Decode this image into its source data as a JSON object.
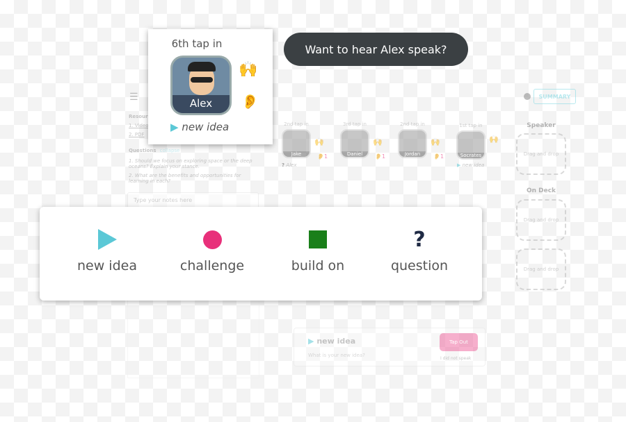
{
  "popup": {
    "tap_label": "6th tap in",
    "name": "Alex",
    "contribution": "new idea"
  },
  "bubble": {
    "text": "Want to hear Alex speak?"
  },
  "sidebar": {
    "resources_label": "Resources",
    "links": [
      "1. Video",
      "2. PDF"
    ],
    "questions_label": "Questions",
    "collapse": "collapse",
    "questions": [
      "1. Should we focus on exploring space or the deep oceans? Explain your stance.",
      "2. What are the benefits and opportunities for learning in each?"
    ],
    "notes_placeholder": "Type your notes here"
  },
  "header": {
    "summary_label": "SUMMARY"
  },
  "participants": [
    {
      "tap": "2nd tap in",
      "name": "Jake",
      "ear_count": "1",
      "note": "Alex"
    },
    {
      "tap": "3rd tap in",
      "name": "Daniel",
      "ear_count": "1"
    },
    {
      "tap": "2nd tap in",
      "name": "Jordan",
      "ear_count": "1"
    },
    {
      "tap": "1st tap in",
      "name": "Socrates",
      "note": "new idea"
    }
  ],
  "speaker": {
    "label": "Speaker",
    "drop": "Drag and drop"
  },
  "on_deck": {
    "label": "On Deck",
    "drops": [
      "Drag and drop",
      "Drag and drop"
    ]
  },
  "legend": {
    "items": [
      {
        "icon": "play-triangle-icon",
        "label": "new idea",
        "color": "#5bc8d6"
      },
      {
        "icon": "circle-icon",
        "label": "challenge",
        "color": "#e8307a"
      },
      {
        "icon": "square-icon",
        "label": "build on",
        "color": "#1a7f1a"
      },
      {
        "icon": "question-mark-icon",
        "label": "question",
        "color": "#1f2a44"
      }
    ]
  },
  "composer": {
    "title": "new idea",
    "placeholder": "What is your new idea?",
    "tap_out": "Tap Out",
    "did_not_speak": "I did not speak"
  }
}
